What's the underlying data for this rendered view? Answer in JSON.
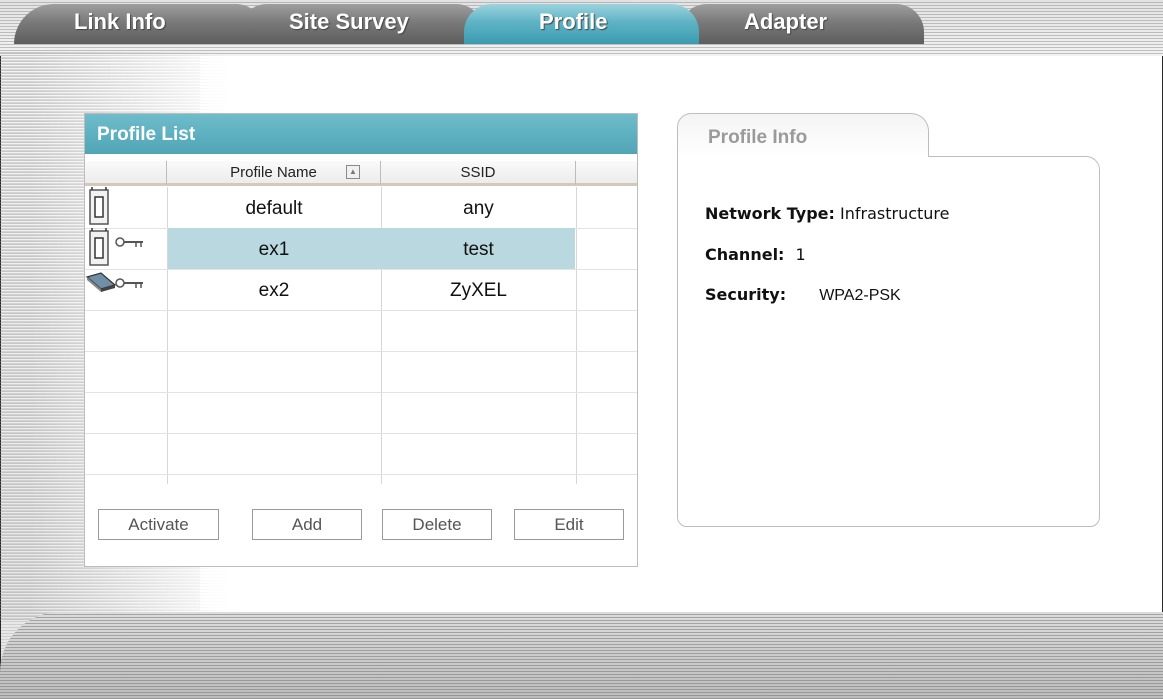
{
  "tabs": [
    {
      "label": "Link Info",
      "active": false
    },
    {
      "label": "Site Survey",
      "active": false
    },
    {
      "label": "Profile",
      "active": true
    },
    {
      "label": "Adapter",
      "active": false
    }
  ],
  "profile_list": {
    "title": "Profile List",
    "columns": [
      "",
      "Profile Name",
      "SSID",
      ""
    ],
    "rows": [
      {
        "icons": [
          "access-point-icon"
        ],
        "name": "default",
        "ssid": "any",
        "selected": false
      },
      {
        "icons": [
          "access-point-icon",
          "key-icon"
        ],
        "name": "ex1",
        "ssid": "test",
        "selected": true
      },
      {
        "icons": [
          "adapter-card-icon",
          "key-icon"
        ],
        "name": "ex2",
        "ssid": "ZyXEL",
        "selected": false
      }
    ],
    "buttons": {
      "activate": "Activate",
      "add": "Add",
      "delete": "Delete",
      "edit": "Edit"
    }
  },
  "profile_info": {
    "title": "Profile Info",
    "network_type_label": "Network Type:",
    "network_type_value": "Infrastructure",
    "channel_label": "Channel:",
    "channel_value": "1",
    "security_label": "Security:",
    "security_value": "WPA2-PSK"
  },
  "colors": {
    "accent": "#5fb3c5",
    "selected_row": "#b9d8df",
    "tab_inactive": "#7a7a7a"
  }
}
